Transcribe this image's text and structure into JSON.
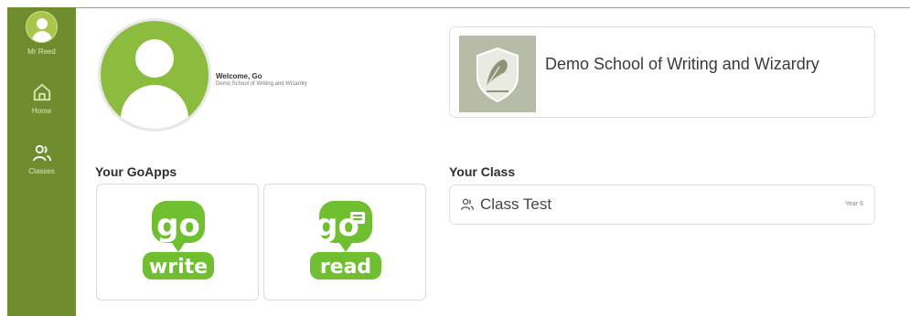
{
  "sidebar": {
    "user_name": "Mr Reed",
    "items": [
      {
        "label": "Home",
        "icon": "home-icon"
      },
      {
        "label": "Classes",
        "icon": "classes-icon"
      }
    ]
  },
  "profile": {
    "welcome": "Welcome, Go",
    "school": "Demo School of Writing and Wizardry"
  },
  "school_card": {
    "name": "Demo School of Writing and Wizardry"
  },
  "goapps": {
    "title": "Your GoApps",
    "apps": [
      {
        "top": "go",
        "bottom": "write",
        "icon": "go-write-logo"
      },
      {
        "top": "go",
        "bottom": "read",
        "icon": "go-read-logo"
      }
    ]
  },
  "your_class": {
    "title": "Your Class",
    "class_name": "Class Test",
    "year": "Year 6"
  },
  "colors": {
    "sidebar": "#6e8d2f",
    "accent_green": "#8cbc3e",
    "logo_green": "#6fbf31"
  }
}
